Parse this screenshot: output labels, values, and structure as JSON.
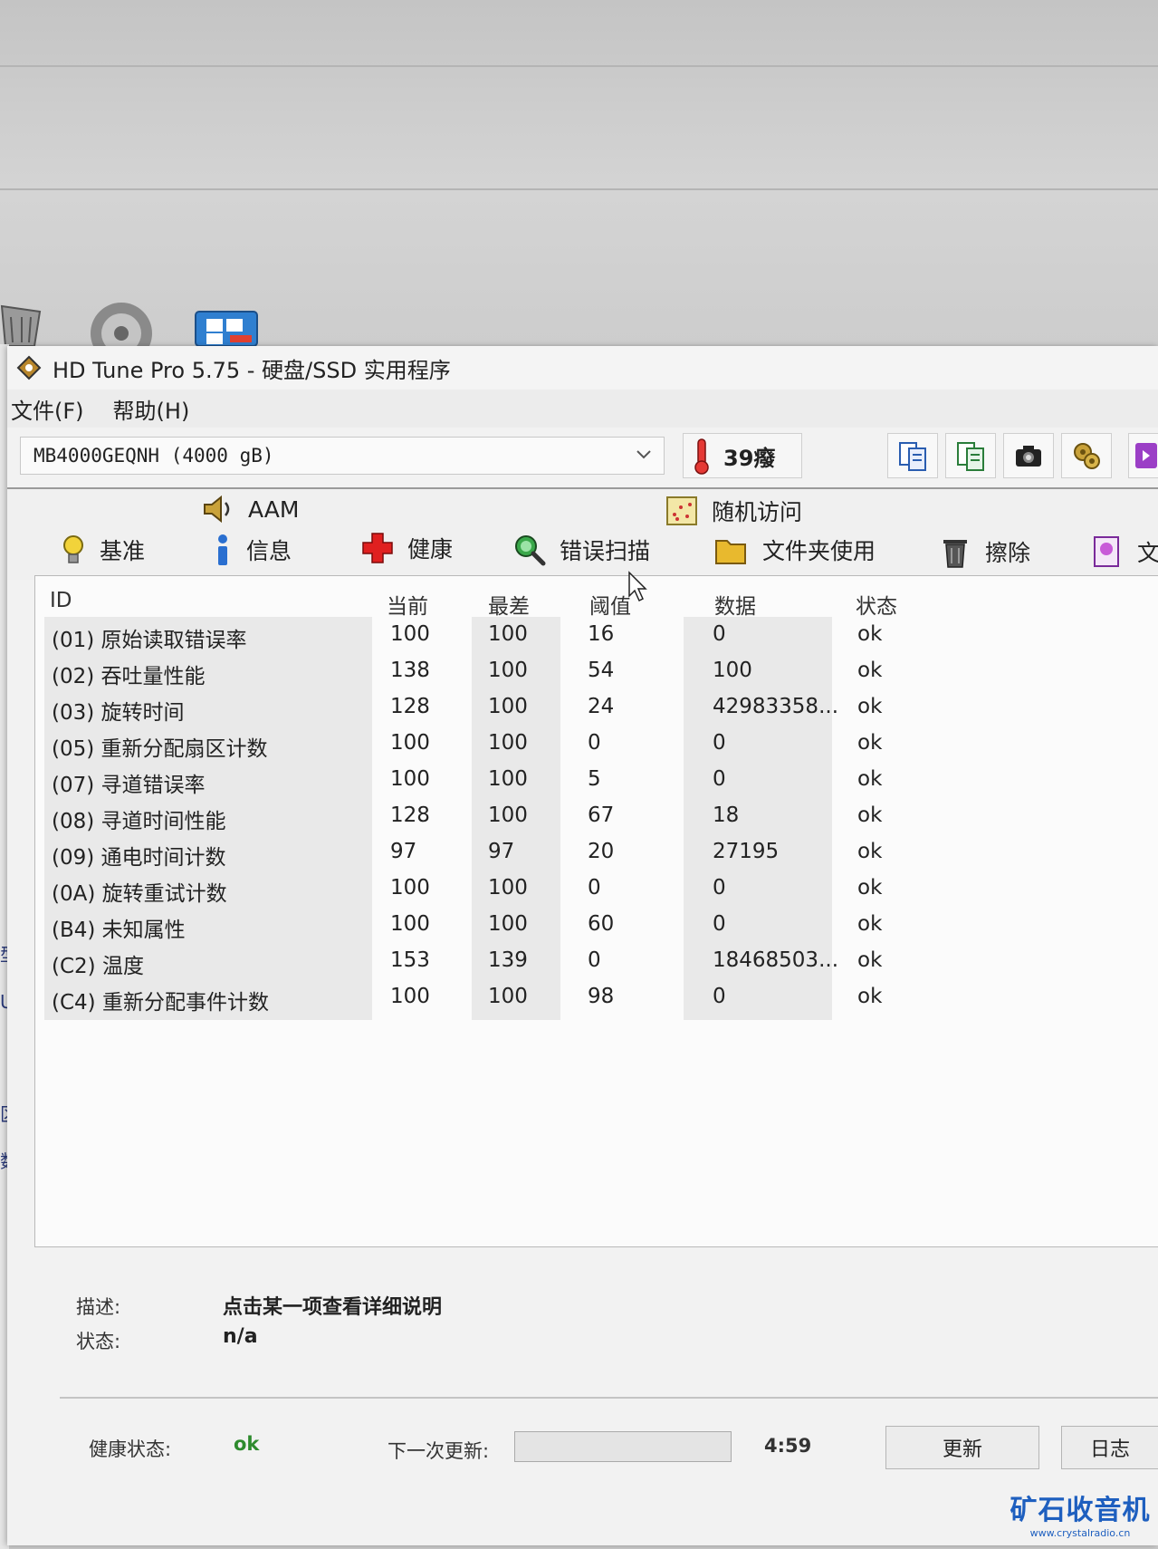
{
  "window": {
    "title": "HD Tune Pro 5.75 - 硬盘/SSD 实用程序"
  },
  "menu": [
    "文件(F)",
    "帮助(H)"
  ],
  "toolbar": {
    "drive": "MB4000GEQNH (4000 gB)",
    "temperature": "39癈"
  },
  "tabs": {
    "aam": "AAM",
    "random_access": "随机访问",
    "benchmark": "基准",
    "info": "信息",
    "health": "健康",
    "error_scan": "错误扫描",
    "folder_usage": "文件夹使用",
    "erase": "擦除",
    "file_partial": "文"
  },
  "table": {
    "headers": {
      "id": "ID",
      "current": "当前",
      "worst": "最差",
      "threshold": "阈值",
      "data": "数据",
      "status": "状态"
    },
    "rows": [
      {
        "id": "(01) 原始读取错误率",
        "current": "100",
        "worst": "100",
        "threshold": "16",
        "data": "0",
        "status": "ok"
      },
      {
        "id": "(02) 吞吐量性能",
        "current": "138",
        "worst": "100",
        "threshold": "54",
        "data": "100",
        "status": "ok"
      },
      {
        "id": "(03) 旋转时间",
        "current": "128",
        "worst": "100",
        "threshold": "24",
        "data": "42983358...",
        "status": "ok"
      },
      {
        "id": "(05) 重新分配扇区计数",
        "current": "100",
        "worst": "100",
        "threshold": "0",
        "data": "0",
        "status": "ok"
      },
      {
        "id": "(07) 寻道错误率",
        "current": "100",
        "worst": "100",
        "threshold": "5",
        "data": "0",
        "status": "ok"
      },
      {
        "id": "(08) 寻道时间性能",
        "current": "128",
        "worst": "100",
        "threshold": "67",
        "data": "18",
        "status": "ok"
      },
      {
        "id": "(09) 通电时间计数",
        "current": "97",
        "worst": "97",
        "threshold": "20",
        "data": "27195",
        "status": "ok"
      },
      {
        "id": "(0A) 旋转重试计数",
        "current": "100",
        "worst": "100",
        "threshold": "0",
        "data": "0",
        "status": "ok"
      },
      {
        "id": "(B4) 未知属性",
        "current": "100",
        "worst": "100",
        "threshold": "60",
        "data": "0",
        "status": "ok"
      },
      {
        "id": "(C2) 温度",
        "current": "153",
        "worst": "139",
        "threshold": "0",
        "data": "18468503...",
        "status": "ok"
      },
      {
        "id": "(C4) 重新分配事件计数",
        "current": "100",
        "worst": "100",
        "threshold": "98",
        "data": "0",
        "status": "ok"
      }
    ]
  },
  "details": {
    "desc_label": "描述:",
    "desc_value": "点击某一项查看详细说明",
    "status_label": "状态:",
    "status_value": "n/a"
  },
  "footer": {
    "health_label": "健康状态:",
    "health_value": "ok",
    "next_update_label": "下一次更新:",
    "next_update_progress": 0,
    "countdown": "4:59",
    "refresh_button": "更新",
    "log_button": "日志"
  },
  "left_fragments": [
    "型:",
    "UID",
    "区数",
    "数:"
  ],
  "watermark": {
    "main": "矿石收音机",
    "sub": "www.crystalradio.cn"
  },
  "colors": {
    "health_ok": "#2e8b2e",
    "watermark": "#1e5fbf"
  }
}
